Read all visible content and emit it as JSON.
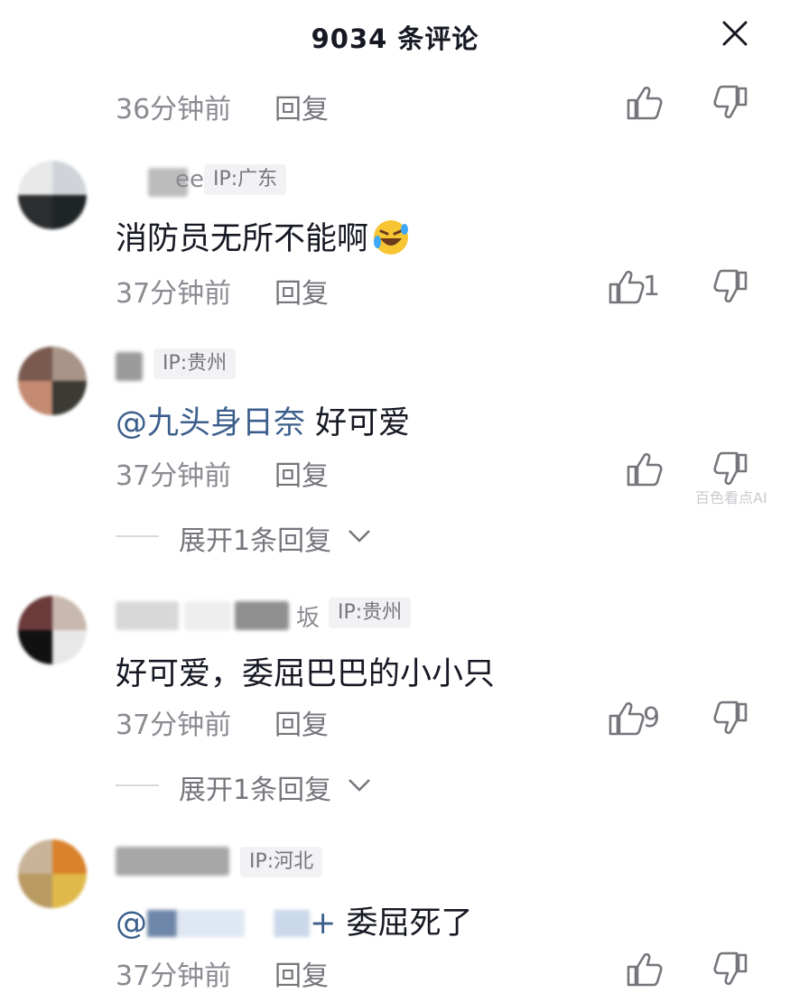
{
  "header": {
    "title": "9034 条评论"
  },
  "comments": [
    {
      "time": "36分钟前",
      "reply": "回复",
      "likes": ""
    },
    {
      "username_tail": "ee",
      "ip": "IP:广东",
      "content": "消防员无所不能啊",
      "time": "37分钟前",
      "reply": "回复",
      "likes": "1"
    },
    {
      "username_tail": "",
      "ip": "IP:贵州",
      "mention": "@九头身日奈",
      "content": " 好可爱",
      "time": "37分钟前",
      "reply": "回复",
      "likes": "",
      "expand": "展开1条回复"
    },
    {
      "username_tail": "坂",
      "ip": "IP:贵州",
      "content": "好可爱，委屈巴巴的小小只",
      "time": "37分钟前",
      "reply": "回复",
      "likes": "9",
      "expand": "展开1条回复"
    },
    {
      "username_tail": "",
      "ip": "IP:河北",
      "mention": "@",
      "mention_tail": "+",
      "content": " 委屈死了",
      "time": "37分钟前",
      "reply": "回复",
      "likes": ""
    }
  ],
  "watermark": "百色看点AI",
  "icons": {
    "close": "close-icon",
    "like": "thumbs-up-icon",
    "dislike": "thumbs-down-icon",
    "chevron": "chevron-down-icon",
    "emoji": "laughing-tears-emoji-icon"
  },
  "colors": {
    "text": "#161823",
    "meta": "#8a8b91",
    "mention": "#3b5f8c",
    "ip_bg": "#f2f2f4"
  }
}
